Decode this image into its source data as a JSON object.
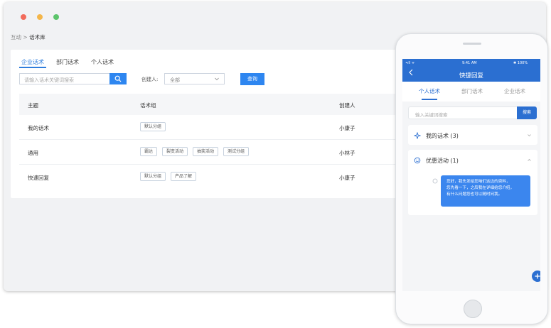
{
  "window": {
    "controls": {
      "close_color": "#f26b5b",
      "min_color": "#f4b64a",
      "max_color": "#5cc46b"
    },
    "breadcrumb": {
      "parent": "互动",
      "separator": ">",
      "current": "话术库"
    },
    "tabs": [
      {
        "label": "企业话术",
        "active": true
      },
      {
        "label": "部门话术",
        "active": false
      },
      {
        "label": "个人话术",
        "active": false
      }
    ],
    "search": {
      "placeholder": "请输入话术关键词搜索"
    },
    "creator_filter": {
      "label": "创建人:",
      "value": "全部"
    },
    "query_button": "查询",
    "table": {
      "columns": [
        "主题",
        "话术组",
        "创建人"
      ],
      "rows": [
        {
          "topic": "我的话术",
          "groups": [
            "默认分组"
          ],
          "creator": "小康子"
        },
        {
          "topic": "通用",
          "groups": [
            "霸达",
            "裂变活动",
            "抽奖活动",
            "测试分组"
          ],
          "creator": "小林子"
        },
        {
          "topic": "快速回复",
          "groups": [
            "默认分组",
            "产品了解"
          ],
          "creator": "小康子"
        }
      ]
    }
  },
  "phone": {
    "status": {
      "signal": "•ıll ᯤ",
      "time": "9:41 AM",
      "battery": "✱ 100%"
    },
    "title": "快捷回复",
    "tabs": [
      {
        "label": "个人话术",
        "active": true
      },
      {
        "label": "部门话术",
        "active": false
      },
      {
        "label": "企业话术",
        "active": false
      }
    ],
    "search": {
      "placeholder": "输入关键词搜索",
      "button": "搜索"
    },
    "groups": [
      {
        "title": "我的话术 (3)",
        "icon": "sparkle-icon",
        "expanded": false
      },
      {
        "title": "优惠活动 (1)",
        "icon": "smiley-icon",
        "expanded": true
      }
    ],
    "message": "您好，我先发给您咱们这边的资料，\n您先看一下，之后我在详细给您介绍，\n有什么问题您也可以随时问我。",
    "accent_color": "#2b6fd1"
  }
}
